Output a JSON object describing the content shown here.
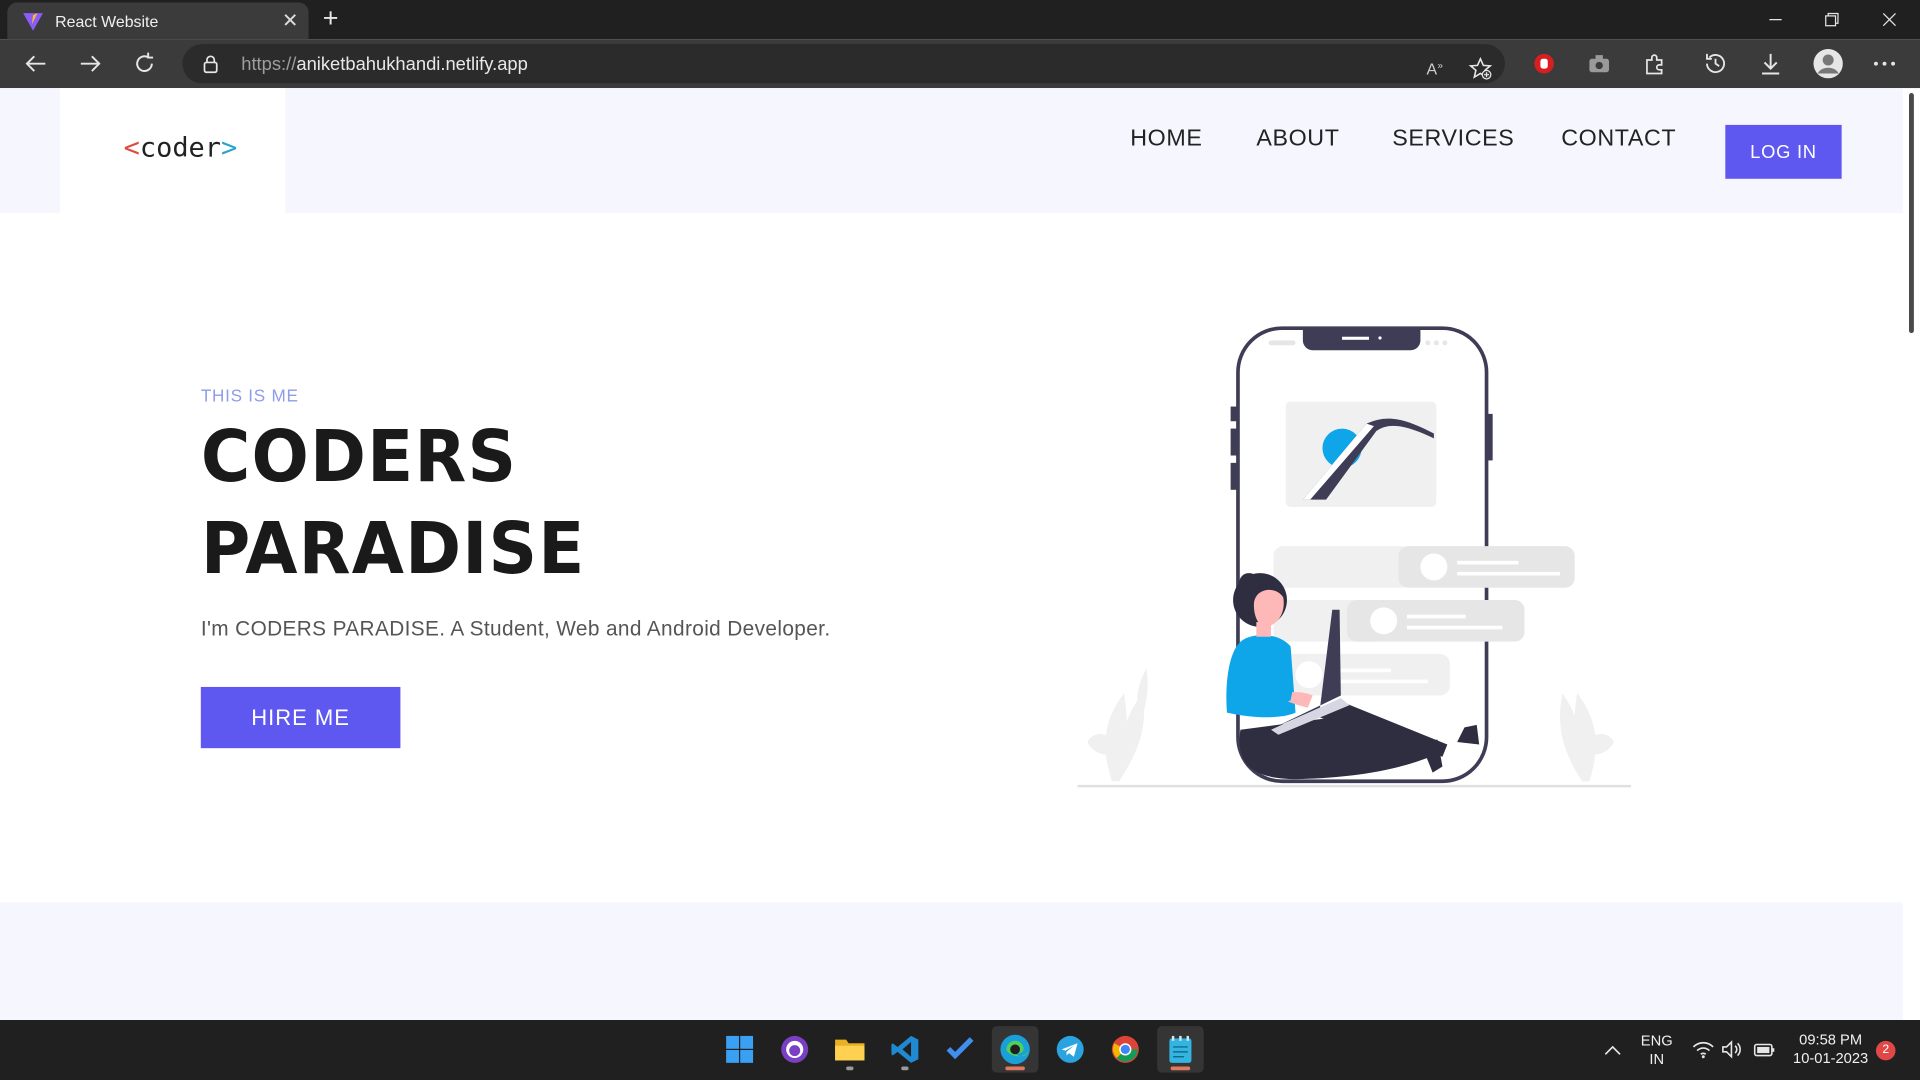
{
  "browser": {
    "tab_title": "React Website",
    "url_scheme": "https://",
    "url_host": "aniketbahukhandi.netlify.app"
  },
  "site": {
    "logo_lt": "<",
    "logo_text": "coder",
    "logo_gt": ">",
    "nav": [
      "HOME",
      "ABOUT",
      "SERVICES",
      "CONTACT"
    ],
    "login_label": "LOG IN"
  },
  "hero": {
    "eyebrow": "THIS IS ME",
    "title_line1": "CODERS",
    "title_line2": "PARADISE",
    "description": "I'm CODERS PARADISE. A Student, Web and Android Developer.",
    "cta_label": "HIRE ME"
  },
  "taskbar": {
    "apps": [
      "windows-start-icon",
      "github-desktop-icon",
      "file-explorer-icon",
      "vscode-icon",
      "todo-icon",
      "edge-icon",
      "telegram-icon",
      "chrome-icon",
      "notepad-icon"
    ],
    "lang_line1": "ENG",
    "lang_line2": "IN",
    "time": "09:58 PM",
    "date": "10-01-2023",
    "notification_count": "2"
  },
  "colors": {
    "accent": "#5e58f0",
    "eyebrow": "#8f9ce8",
    "header_bg": "#f6f6fe",
    "illustration_blue": "#0ea5e9"
  }
}
